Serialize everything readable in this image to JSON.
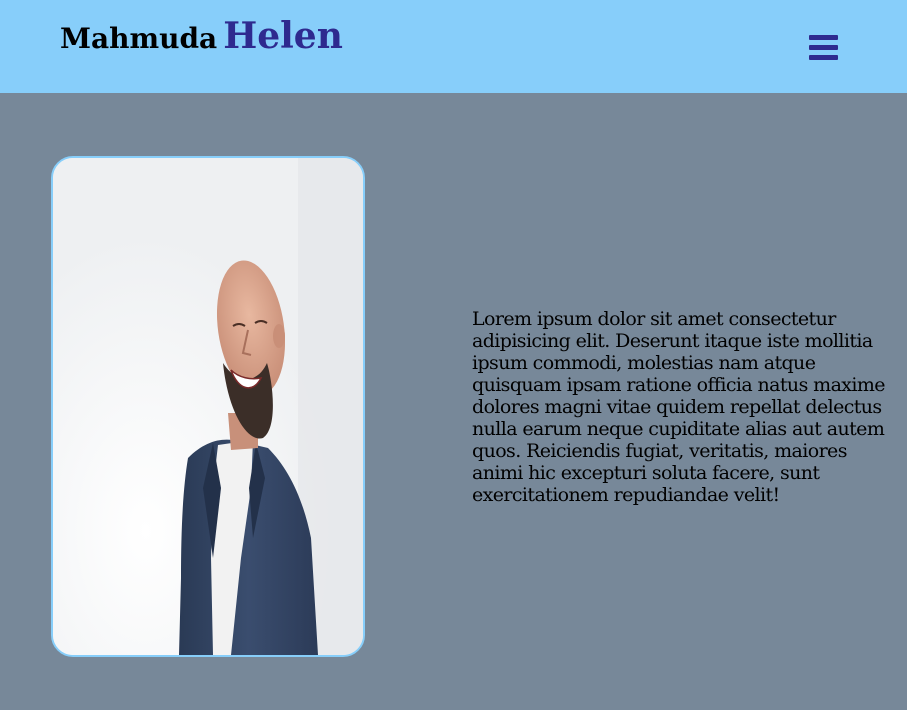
{
  "header": {
    "brand_first": "Mahmuda",
    "brand_last": "Helen",
    "menu_icon": "hamburger-menu-icon"
  },
  "hero": {
    "photo_subject": "profile-photo",
    "bio": "Lorem ipsum dolor sit amet consectetur adipisicing elit. Deserunt itaque iste mollitia ipsum commodi, molestias nam atque quisquam ipsam ratione officia natus maxime dolores magni vitae quidem repellat delectus nulla earum neque cupiditate alias aut autem quos. Reiciendis fugiat, veritatis, maiores animi hic excepturi soluta facere, sunt exercitationem repudiandae velit!"
  },
  "colors": {
    "header_bg": "#87cefa",
    "page_bg": "#778899",
    "accent": "#2e2a8f",
    "frame_border": "#87cefa"
  }
}
